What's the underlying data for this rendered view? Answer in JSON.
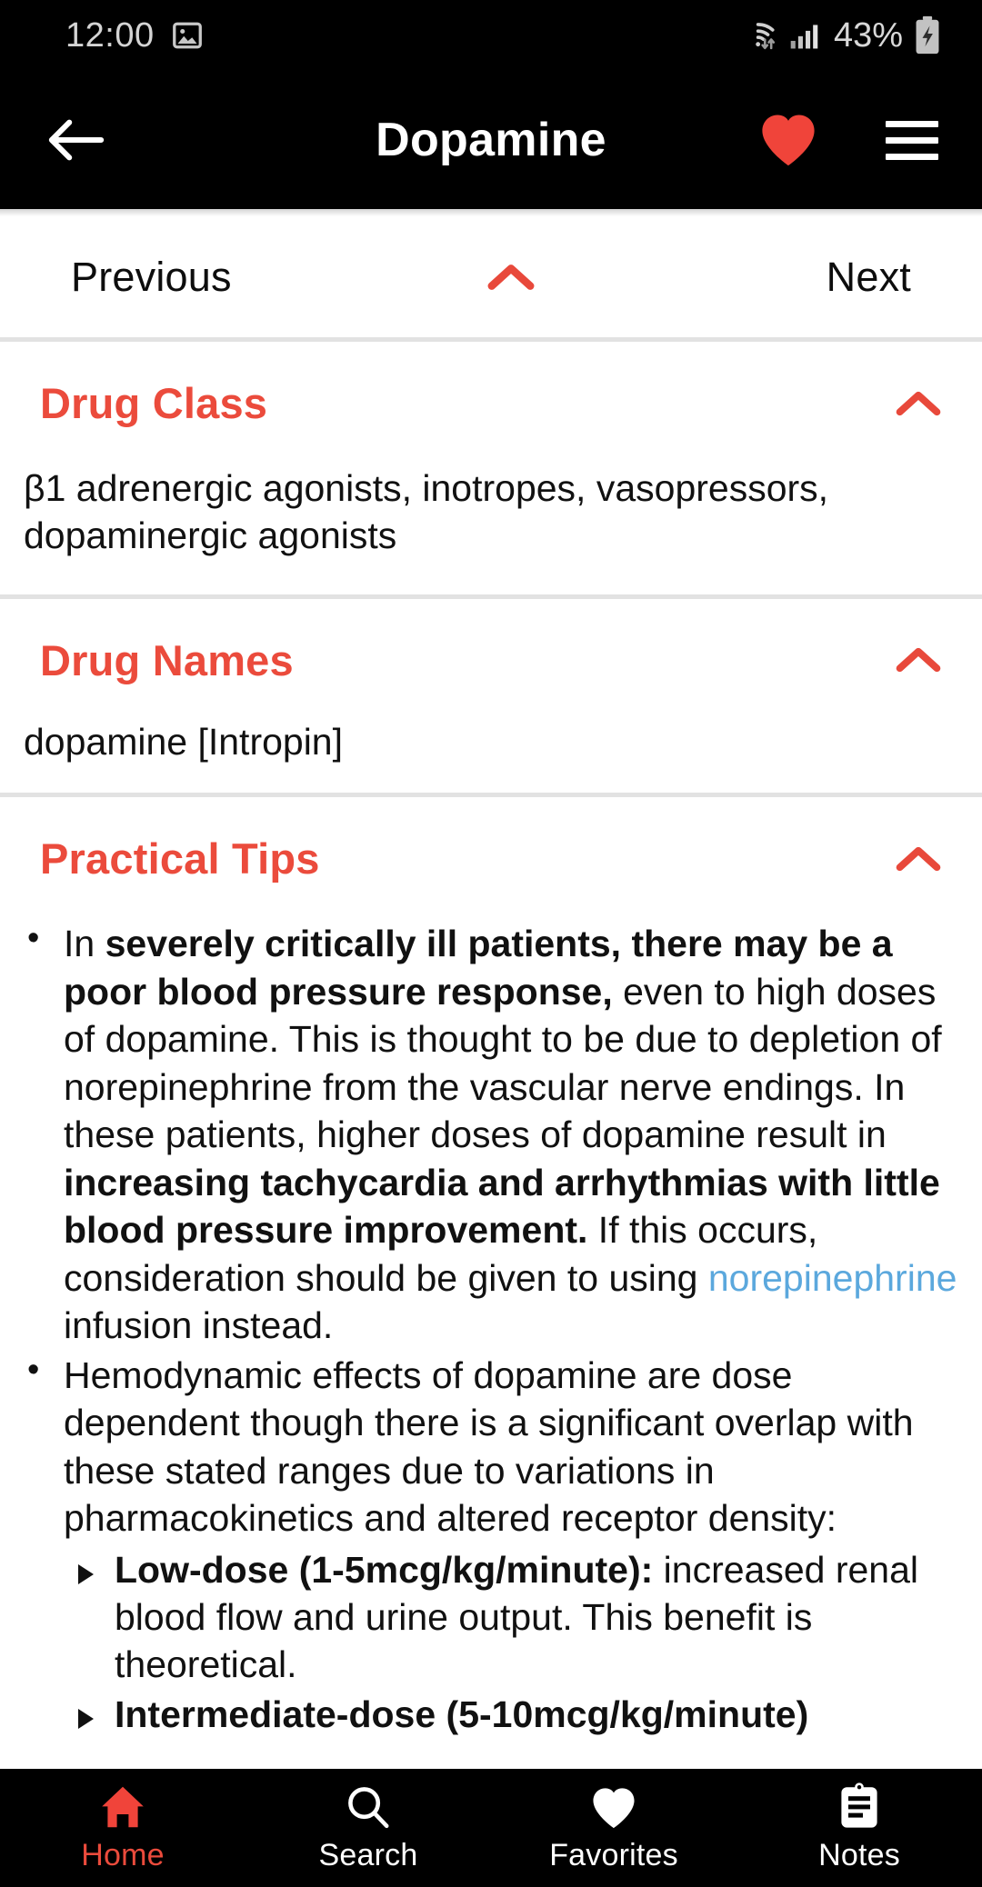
{
  "theme": {
    "accent_red": "#eb4b3c",
    "heart_red": "#f0443a",
    "link_blue": "#5ba8dd",
    "bar_black": "#000000",
    "divider_gray": "#e2e2e2"
  },
  "status_bar": {
    "time": "12:00",
    "screenshot_icon": "image-icon",
    "wifi_icon": "wifi-icon",
    "cellular_icon": "cellular-signal-icon",
    "battery_percent": "43%",
    "battery_icon": "battery-charging-icon"
  },
  "app_bar": {
    "back_icon": "back-arrow-icon",
    "title": "Dopamine",
    "favorite_icon": "heart-filled-icon",
    "menu_icon": "hamburger-menu-icon"
  },
  "pager": {
    "previous_label": "Previous",
    "next_label": "Next",
    "collapse_icon": "chevron-up-icon"
  },
  "sections": [
    {
      "title": "Drug Class",
      "toggle_icon": "chevron-up-icon",
      "body": "β1 adrenergic agonists, inotropes, vasopressors, dopaminergic agonists"
    },
    {
      "title": "Drug Names",
      "toggle_icon": "chevron-up-icon",
      "body": "dopamine [Intropin]"
    },
    {
      "title": "Practical Tips",
      "toggle_icon": "chevron-up-icon"
    }
  ],
  "practical_tips": {
    "bullet1": {
      "p1_plain": "In ",
      "p2_bold": "severely critically ill patients, there may be a poor blood pressure response,",
      "p3_plain": " even to high doses of dopamine. This is thought to be due to depletion of norepinephrine from the vascular nerve endings. In these patients, higher doses of dopamine result in ",
      "p4_bold": "increasing tachycardia and arrhythmias with little blood pressure improvement.",
      "p5_plain": " If this occurs, consideration should be given to using ",
      "p6_link": "norepinephrine",
      "p7_plain": " infusion instead."
    },
    "bullet2": {
      "text": "Hemodynamic effects of dopamine are dose dependent though there is a significant overlap with these stated ranges due to variations in pharmacokinetics and altered receptor density:",
      "sub": [
        {
          "bold": "Low-dose (1-5mcg/kg/minute):",
          "plain": " increased renal blood flow and urine output. This benefit is theoretical."
        },
        {
          "bold": "Intermediate-dose (5-10mcg/kg/minute)",
          "plain": ""
        }
      ]
    }
  },
  "bottom_nav": {
    "items": [
      {
        "label": "Home",
        "icon": "home-icon",
        "active": true
      },
      {
        "label": "Search",
        "icon": "search-icon",
        "active": false
      },
      {
        "label": "Favorites",
        "icon": "heart-icon",
        "active": false
      },
      {
        "label": "Notes",
        "icon": "clipboard-notes-icon",
        "active": false
      }
    ]
  }
}
